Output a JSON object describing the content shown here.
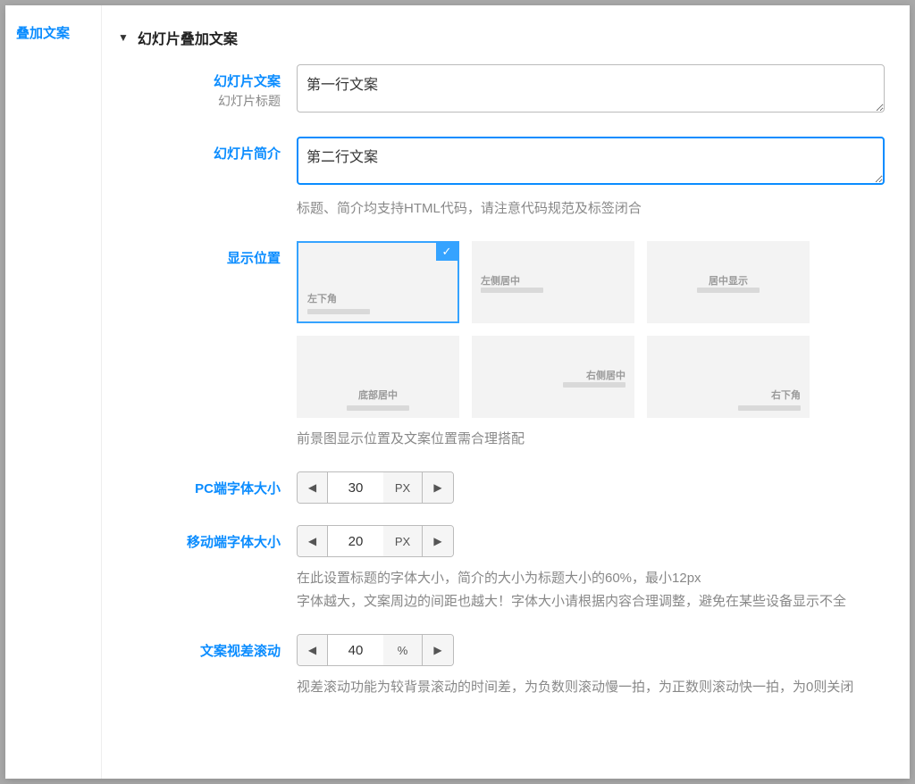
{
  "sidebar": {
    "active_tab": "叠加文案"
  },
  "section": {
    "title": "幻灯片叠加文案"
  },
  "fields": {
    "text": {
      "label": "幻灯片文案",
      "sublabel": "幻灯片标题",
      "value": "第一行文案"
    },
    "intro": {
      "label": "幻灯片简介",
      "value": "第二行文案",
      "help": "标题、简介均支持HTML代码，请注意代码规范及标签闭合"
    },
    "position": {
      "label": "显示位置",
      "options": [
        "左下角",
        "左侧居中",
        "居中显示",
        "底部居中",
        "右侧居中",
        "右下角"
      ],
      "selected": 0,
      "help": "前景图显示位置及文案位置需合理搭配"
    },
    "pc_font": {
      "label": "PC端字体大小",
      "value": "30",
      "unit": "PX"
    },
    "mobile_font": {
      "label": "移动端字体大小",
      "value": "20",
      "unit": "PX",
      "help1": "在此设置标题的字体大小，简介的大小为标题大小的60%，最小12px",
      "help2": "字体越大，文案周边的间距也越大！字体大小请根据内容合理调整，避免在某些设备显示不全"
    },
    "parallax": {
      "label": "文案视差滚动",
      "value": "40",
      "unit": "%",
      "help": "视差滚动功能为较背景滚动的时间差，为负数则滚动慢一拍，为正数则滚动快一拍，为0则关闭"
    }
  }
}
